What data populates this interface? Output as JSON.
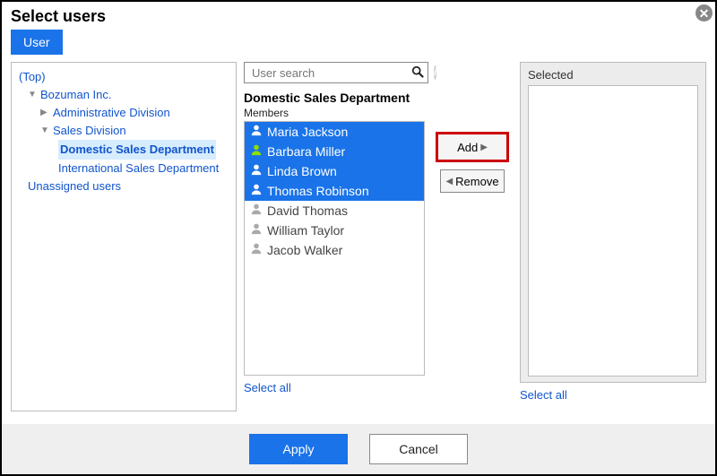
{
  "dialog": {
    "title": "Select users",
    "tab_label": "User"
  },
  "tree": {
    "top": "(Top)",
    "org": "Bozuman Inc.",
    "admin": "Administrative Division",
    "sales": "Sales Division",
    "domestic": "Domestic Sales Department",
    "international": "International Sales Department",
    "unassigned": "Unassigned users"
  },
  "search": {
    "placeholder": "User search"
  },
  "group": {
    "name": "Domestic Sales Department",
    "members_label": "Members",
    "select_all": "Select all"
  },
  "members": [
    {
      "name": "Maria Jackson",
      "selected": true,
      "accent": "white"
    },
    {
      "name": "Barbara Miller",
      "selected": true,
      "accent": "green"
    },
    {
      "name": "Linda Brown",
      "selected": true,
      "accent": "white"
    },
    {
      "name": "Thomas Robinson",
      "selected": true,
      "accent": "white"
    },
    {
      "name": "David Thomas",
      "selected": false,
      "accent": "gray"
    },
    {
      "name": "William Taylor",
      "selected": false,
      "accent": "gray"
    },
    {
      "name": "Jacob Walker",
      "selected": false,
      "accent": "gray"
    }
  ],
  "buttons": {
    "add": "Add",
    "remove": "Remove"
  },
  "selected_panel": {
    "header": "Selected",
    "select_all": "Select all"
  },
  "footer": {
    "apply": "Apply",
    "cancel": "Cancel"
  }
}
